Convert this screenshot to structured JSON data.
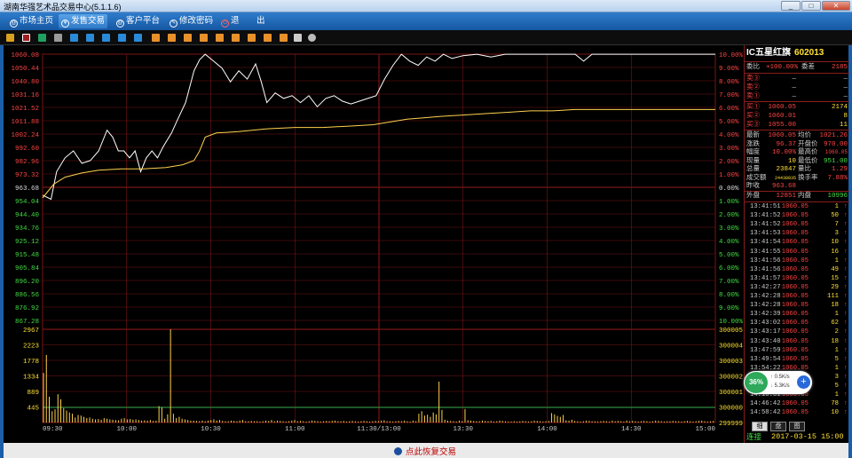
{
  "window": {
    "title": "湖南华强艺术品交易中心(5.1.1.6)",
    "min": "_",
    "max": "□",
    "close": "✕"
  },
  "menu": [
    {
      "label": "市场主页",
      "icon": "@"
    },
    {
      "label": "发售交易",
      "icon": "¥",
      "active": true
    },
    {
      "label": "客户平台",
      "icon": "@"
    },
    {
      "label": "修改密码",
      "icon": "✎"
    },
    {
      "label": "退",
      "icon": "⏻"
    },
    {
      "label": "出",
      "icon": ""
    }
  ],
  "chart_data": [
    {
      "type": "line",
      "title": "",
      "x_labels": [
        "09:30",
        "10:00",
        "10:30",
        "11:00",
        "11:30/13:00",
        "13:30",
        "14:00",
        "14:30",
        "15:00"
      ],
      "y_left_labels": [
        "1060.08",
        "1050.44",
        "1040.80",
        "1031.16",
        "1021.52",
        "1011.88",
        "1002.24",
        "992.60",
        "982.96",
        "973.32",
        "963.68",
        "954.04",
        "944.40",
        "934.76",
        "925.12",
        "915.48",
        "905.84",
        "896.20",
        "886.56",
        "876.92",
        "867.28"
      ],
      "y_right_labels": [
        "10.00%",
        "9.00%",
        "8.00%",
        "7.00%",
        "6.00%",
        "5.00%",
        "4.00%",
        "3.00%",
        "2.00%",
        "1.00%",
        "0.00%",
        "1.00%",
        "2.00%",
        "3.00%",
        "4.00%",
        "5.00%",
        "6.00%",
        "7.00%",
        "8.00%",
        "9.00%",
        "10.00%"
      ],
      "ylim": [
        867.28,
        1060.08
      ],
      "prev_close": 963.68,
      "series": [
        {
          "name": "",
          "color": "#ffffff",
          "points": [
            [
              0,
              958
            ],
            [
              3,
              955
            ],
            [
              5,
              975
            ],
            [
              8,
              985
            ],
            [
              11,
              990
            ],
            [
              14,
              981
            ],
            [
              17,
              983
            ],
            [
              20,
              990
            ],
            [
              23,
              1005
            ],
            [
              25,
              1000
            ],
            [
              27,
              990
            ],
            [
              29,
              990
            ],
            [
              31,
              985
            ],
            [
              33,
              990
            ],
            [
              35,
              975
            ],
            [
              37,
              985
            ],
            [
              39,
              990
            ],
            [
              41,
              985
            ],
            [
              43,
              993
            ],
            [
              46,
              1003
            ],
            [
              48,
              1012
            ],
            [
              51,
              1025
            ],
            [
              54,
              1048
            ],
            [
              56,
              1056
            ],
            [
              58,
              1060
            ],
            [
              61,
              1055
            ],
            [
              64,
              1050
            ],
            [
              67,
              1040
            ],
            [
              70,
              1048
            ],
            [
              73,
              1042
            ],
            [
              76,
              1053
            ],
            [
              78,
              1040
            ],
            [
              80,
              1025
            ],
            [
              83,
              1032
            ],
            [
              86,
              1028
            ],
            [
              89,
              1030
            ],
            [
              92,
              1025
            ],
            [
              95,
              1030
            ],
            [
              98,
              1022
            ],
            [
              101,
              1028
            ],
            [
              104,
              1030
            ],
            [
              107,
              1026
            ],
            [
              110,
              1024
            ],
            [
              113,
              1026
            ],
            [
              116,
              1028
            ],
            [
              119,
              1030
            ],
            [
              122,
              1042
            ],
            [
              125,
              1052
            ],
            [
              128,
              1060
            ],
            [
              131,
              1055
            ],
            [
              134,
              1052
            ],
            [
              137,
              1058
            ],
            [
              140,
              1055
            ],
            [
              143,
              1060
            ],
            [
              146,
              1057
            ],
            [
              150,
              1059
            ],
            [
              155,
              1060
            ],
            [
              160,
              1058
            ],
            [
              165,
              1060
            ],
            [
              170,
              1060
            ],
            [
              175,
              1060
            ],
            [
              180,
              1060
            ],
            [
              185,
              1060
            ],
            [
              190,
              1060
            ],
            [
              193,
              1055
            ],
            [
              196,
              1060
            ],
            [
              200,
              1060
            ],
            [
              206,
              1060
            ],
            [
              212,
              1060
            ],
            [
              218,
              1060
            ],
            [
              224,
              1060
            ],
            [
              230,
              1060
            ],
            [
              236,
              1060
            ],
            [
              240,
              1060
            ]
          ]
        },
        {
          "name": "",
          "color": "#ffd24d",
          "points": [
            [
              0,
              956
            ],
            [
              4,
              966
            ],
            [
              8,
              971
            ],
            [
              14,
              974
            ],
            [
              20,
              976
            ],
            [
              28,
              977
            ],
            [
              36,
              977
            ],
            [
              44,
              978
            ],
            [
              50,
              980
            ],
            [
              54,
              983
            ],
            [
              56,
              990
            ],
            [
              58,
              1000
            ],
            [
              62,
              1003
            ],
            [
              70,
              1004
            ],
            [
              80,
              1006
            ],
            [
              90,
              1007
            ],
            [
              100,
              1007
            ],
            [
              110,
              1008
            ],
            [
              118,
              1009
            ],
            [
              124,
              1011
            ],
            [
              130,
              1013
            ],
            [
              136,
              1014
            ],
            [
              142,
              1015
            ],
            [
              150,
              1016
            ],
            [
              158,
              1017
            ],
            [
              166,
              1018
            ],
            [
              174,
              1019
            ],
            [
              182,
              1019
            ],
            [
              190,
              1020
            ],
            [
              200,
              1020
            ],
            [
              210,
              1020
            ],
            [
              220,
              1020
            ],
            [
              230,
              1020
            ],
            [
              240,
              1020
            ]
          ]
        }
      ]
    },
    {
      "type": "bar",
      "title": "",
      "y_left_labels": [
        "2967",
        "2223",
        "1778",
        "1334",
        "889",
        "445"
      ],
      "y_right_labels": [
        "300005",
        "300004",
        "300003",
        "300002",
        "300001",
        "300000",
        "299999"
      ],
      "ylim": [
        0,
        2967
      ],
      "volumes": [
        1580,
        2150,
        820,
        360,
        420,
        900,
        740,
        460,
        380,
        320,
        280,
        160,
        240,
        220,
        180,
        140,
        160,
        120,
        100,
        110,
        90,
        140,
        120,
        100,
        90,
        80,
        70,
        120,
        140,
        100,
        110,
        90,
        100,
        80,
        60,
        70,
        60,
        80,
        50,
        60,
        520,
        480,
        120,
        260,
        2967,
        280,
        140,
        180,
        120,
        100,
        80,
        60,
        60,
        50,
        40,
        60,
        40,
        60,
        80,
        100,
        60,
        80,
        50,
        40,
        40,
        60,
        50,
        40,
        60,
        80,
        40,
        40,
        50,
        40,
        40,
        30,
        40,
        60,
        50,
        80,
        40,
        60,
        50,
        40,
        30,
        40,
        60,
        80,
        40,
        50,
        40,
        30,
        40,
        60,
        50,
        40,
        30,
        40,
        50,
        40,
        50,
        60,
        40,
        40,
        50,
        30,
        40,
        50,
        40,
        30,
        40,
        50,
        40,
        30,
        40,
        50,
        40,
        60,
        70,
        40,
        40,
        30,
        40,
        50,
        40,
        60,
        40,
        30,
        60,
        40,
        280,
        360,
        220,
        250,
        180,
        320,
        260,
        1300,
        400,
        90,
        60,
        50,
        40,
        30,
        60,
        40,
        430,
        70,
        60,
        50,
        40,
        40,
        60,
        50,
        40,
        50,
        30,
        40,
        60,
        50,
        40,
        30,
        30,
        40,
        30,
        40,
        50,
        40,
        30,
        40,
        60,
        50,
        40,
        30,
        40,
        50,
        300,
        260,
        210,
        180,
        240,
        70,
        60,
        90,
        50,
        40,
        30,
        40,
        60,
        50,
        40,
        40,
        30,
        40,
        50,
        40,
        30,
        60,
        40,
        50,
        40,
        30,
        60,
        40,
        50,
        40,
        30,
        40,
        50,
        40,
        30,
        40,
        60,
        50,
        40,
        30,
        40,
        40,
        50,
        40,
        40,
        30,
        40,
        50,
        40,
        30,
        40,
        50,
        60,
        40,
        30,
        40,
        50
      ]
    }
  ],
  "quote": {
    "name": "IC五星红旗",
    "code": "602013",
    "weibi_label": "委比",
    "weibi": "+100.00%",
    "weicha_label": "委差",
    "weicha": "2185",
    "sells": [
      {
        "label": "卖③",
        "price": "—",
        "vol": "—"
      },
      {
        "label": "卖②",
        "price": "—",
        "vol": "—"
      },
      {
        "label": "卖①",
        "price": "—",
        "vol": "—"
      }
    ],
    "buys": [
      {
        "label": "买①",
        "price": "1060.05",
        "vol": "2174"
      },
      {
        "label": "买②",
        "price": "1060.01",
        "vol": "8"
      },
      {
        "label": "买③",
        "price": "1055.00",
        "vol": "11"
      }
    ],
    "stats": [
      {
        "l1": "最新",
        "v1": "1060.05",
        "l2": "均价",
        "v2": "1021.26"
      },
      {
        "l1": "涨跌",
        "v1": "96.37",
        "l2": "开盘价",
        "v2": "970.00"
      },
      {
        "l1": "幅度",
        "v1": "10.00%",
        "l2": "最高价",
        "v2": "1060.05"
      },
      {
        "l1": "现量",
        "v1": "10",
        "l2": "最低价",
        "v2": "951.00"
      },
      {
        "l1": "总量",
        "v1": "23847",
        "l2": "量比",
        "v2": "1.29"
      },
      {
        "l1": "成交额",
        "v1": "24438035",
        "l2": "换手率",
        "v2": "7.88%"
      },
      {
        "l1": "昨收",
        "v1": "963.68",
        "l2": "",
        "v2": ""
      }
    ],
    "waipan_label": "外盘",
    "waipan": "12851",
    "neipan_label": "内盘",
    "neipan": "10996"
  },
  "ticks": [
    {
      "t": "13:41:51",
      "p": "1060.05",
      "v": "1"
    },
    {
      "t": "13:41:52",
      "p": "1060.05",
      "v": "50"
    },
    {
      "t": "13:41:52",
      "p": "1060.05",
      "v": "7"
    },
    {
      "t": "13:41:53",
      "p": "1060.05",
      "v": "3"
    },
    {
      "t": "13:41:54",
      "p": "1060.05",
      "v": "10"
    },
    {
      "t": "13:41:55",
      "p": "1060.05",
      "v": "16"
    },
    {
      "t": "13:41:56",
      "p": "1060.05",
      "v": "1"
    },
    {
      "t": "13:41:56",
      "p": "1060.05",
      "v": "49"
    },
    {
      "t": "13:41:57",
      "p": "1060.05",
      "v": "15"
    },
    {
      "t": "13:42:27",
      "p": "1060.05",
      "v": "29"
    },
    {
      "t": "13:42:28",
      "p": "1060.05",
      "v": "111"
    },
    {
      "t": "13:42:28",
      "p": "1060.05",
      "v": "18"
    },
    {
      "t": "13:42:39",
      "p": "1060.05",
      "v": "1"
    },
    {
      "t": "13:43:02",
      "p": "1060.05",
      "v": "62"
    },
    {
      "t": "13:43:17",
      "p": "1060.05",
      "v": "2"
    },
    {
      "t": "13:43:40",
      "p": "1060.05",
      "v": "18"
    },
    {
      "t": "13:47:59",
      "p": "1060.05",
      "v": "1"
    },
    {
      "t": "13:49:54",
      "p": "1060.05",
      "v": "5"
    },
    {
      "t": "13:54:22",
      "p": "1060.05",
      "v": "1"
    },
    {
      "t": "14:01:00",
      "p": "1060.05",
      "v": "3"
    },
    {
      "t": "14:05:12",
      "p": "1060.05",
      "v": "5"
    },
    {
      "t": "14:10:31",
      "p": "1060.05",
      "v": "1"
    },
    {
      "t": "14:46:42",
      "p": "1060.05",
      "v": "78"
    },
    {
      "t": "14:58:42",
      "p": "1060.05",
      "v": "10"
    }
  ],
  "tick_arrow": "↑",
  "tabs": [
    "细",
    "盘",
    "图"
  ],
  "status": {
    "conn": "连接",
    "datetime": "2017-03-15 15:00",
    "resume": "点此恢复交易"
  },
  "bubble": {
    "pct": "36%",
    "up": "0.5K/s",
    "down": "5.3K/s",
    "plus": "+"
  },
  "colors": {
    "up": "#ff4444",
    "grid": "#7a1515",
    "price_line": "#ffffff",
    "avg_line": "#ffd24d",
    "volume": "#ffd24d"
  }
}
